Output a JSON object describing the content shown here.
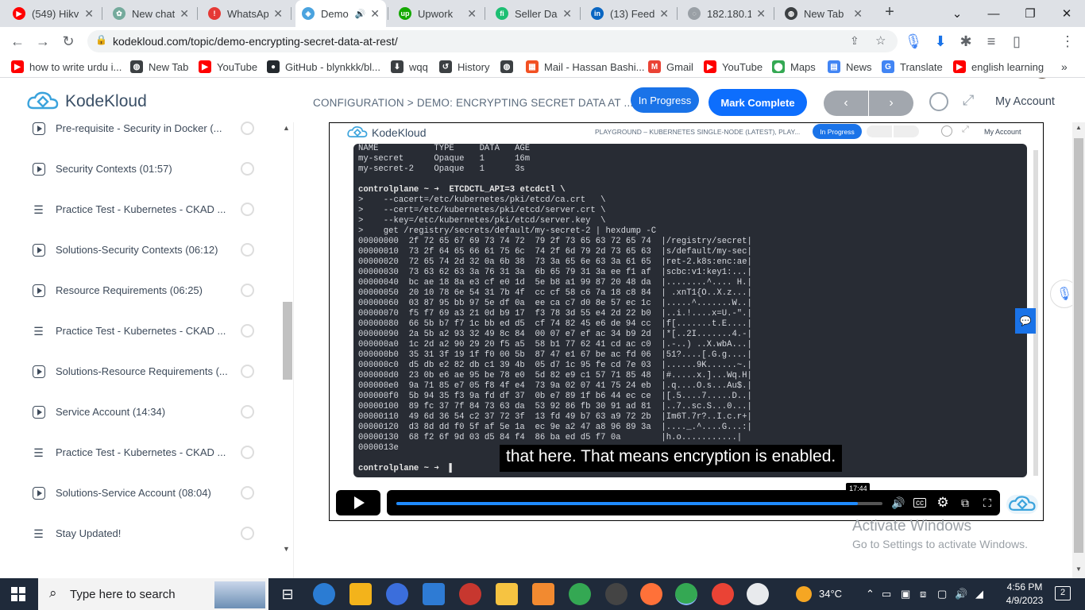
{
  "browser": {
    "tabs": [
      {
        "title": "(549) Hikvi",
        "fav_color": "#ff0000",
        "fav_glyph": "▶"
      },
      {
        "title": "New chat",
        "fav_color": "#74aa9c",
        "fav_glyph": "✿"
      },
      {
        "title": "WhatsApp",
        "fav_color": "#e53935",
        "fav_glyph": "!"
      },
      {
        "title": "Demo",
        "fav_color": "#4aa3df",
        "fav_glyph": "◈",
        "active": true
      },
      {
        "title": "Upwork",
        "fav_color": "#14a800",
        "fav_glyph": "up"
      },
      {
        "title": "Seller Dash",
        "fav_color": "#1dbf73",
        "fav_glyph": "fi"
      },
      {
        "title": "(13) Feed |",
        "fav_color": "#0a66c2",
        "fav_glyph": "in"
      },
      {
        "title": "182.180.14",
        "fav_color": "#9aa0a6",
        "fav_glyph": "◌"
      },
      {
        "title": "New Tab",
        "fav_color": "#3c4043",
        "fav_glyph": "◍"
      }
    ],
    "new_tab_symbol": "+",
    "window_controls": [
      "⌄",
      "—",
      "❐",
      "✕"
    ],
    "url": "kodekloud.com/topic/demo-encrypting-secret-data-at-rest/",
    "bookmarks": [
      {
        "label": "how to write urdu i...",
        "color": "#ff0000",
        "glyph": "▶"
      },
      {
        "label": "New Tab",
        "color": "#3c4043",
        "glyph": "◍"
      },
      {
        "label": "YouTube",
        "color": "#ff0000",
        "glyph": "▶"
      },
      {
        "label": "GitHub - blynkkk/bl...",
        "color": "#24292e",
        "glyph": "●"
      },
      {
        "label": "wqq",
        "color": "#3c4043",
        "glyph": "⬇"
      },
      {
        "label": "History",
        "color": "#3c4043",
        "glyph": "↺"
      },
      {
        "label": "",
        "color": "#3c4043",
        "glyph": "◍"
      },
      {
        "label": "Mail - Hassan Bashi...",
        "color": "#f25022",
        "glyph": "▦"
      },
      {
        "label": "Gmail",
        "color": "#ea4335",
        "glyph": "M"
      },
      {
        "label": "YouTube",
        "color": "#ff0000",
        "glyph": "▶"
      },
      {
        "label": "Maps",
        "color": "#34a853",
        "glyph": "⬤"
      },
      {
        "label": "News",
        "color": "#4285f4",
        "glyph": "▤"
      },
      {
        "label": "Translate",
        "color": "#4285f4",
        "glyph": "G"
      },
      {
        "label": "english learning",
        "color": "#ff0000",
        "glyph": "▶"
      }
    ]
  },
  "app": {
    "logo_text": "KodeKloud",
    "breadcrumb": "CONFIGURATION > DEMO: ENCRYPTING SECRET DATA AT ...",
    "in_progress": "In Progress",
    "mark_complete": "Mark Complete",
    "prev": "‹",
    "next": "›",
    "account": "My Account",
    "accent": "#1a73e8",
    "mark_color": "#0d6efd"
  },
  "sidebar": {
    "items": [
      {
        "label": "Pre-requisite - Security in Docker (...",
        "type": "video"
      },
      {
        "label": "Security Contexts (01:57)",
        "type": "video"
      },
      {
        "label": "Practice Test - Kubernetes - CKAD ...",
        "type": "lab"
      },
      {
        "label": "Solutions-Security Contexts (06:12)",
        "type": "video"
      },
      {
        "label": "Resource Requirements (06:25)",
        "type": "video"
      },
      {
        "label": "Practice Test - Kubernetes - CKAD ...",
        "type": "lab"
      },
      {
        "label": "Solutions-Resource Requirements (...",
        "type": "video"
      },
      {
        "label": "Service Account (14:34)",
        "type": "video"
      },
      {
        "label": "Practice Test - Kubernetes - CKAD ...",
        "type": "lab"
      },
      {
        "label": "Solutions-Service Account (08:04)",
        "type": "video"
      },
      {
        "label": "Stay Updated!",
        "type": "lab"
      }
    ]
  },
  "video": {
    "inner_logo": "KodeKloud",
    "inner_breadcrumb": "PLAYGROUND – KUBERNETES SINGLE-NODE (LATEST), PLAY...",
    "inner_progress": "In Progress",
    "inner_account": "My Account",
    "terminal_lines": [
      "NAME           TYPE     DATA   AGE",
      "my-secret      Opaque   1      16m",
      "my-secret-2    Opaque   1      3s",
      "",
      "controlplane ~ ➜  ETCDCTL_API=3 etcdctl \\",
      ">    --cacert=/etc/kubernetes/pki/etcd/ca.crt   \\",
      ">    --cert=/etc/kubernetes/pki/etcd/server.crt \\",
      ">    --key=/etc/kubernetes/pki/etcd/server.key  \\",
      ">    get /registry/secrets/default/my-secret-2 | hexdump -C",
      "00000000  2f 72 65 67 69 73 74 72  79 2f 73 65 63 72 65 74  |/registry/secret|",
      "00000010  73 2f 64 65 66 61 75 6c  74 2f 6d 79 2d 73 65 63  |s/default/my-sec|",
      "00000020  72 65 74 2d 32 0a 6b 38  73 3a 65 6e 63 3a 61 65  |ret-2.k8s:enc:ae|",
      "00000030  73 63 62 63 3a 76 31 3a  6b 65 79 31 3a ee f1 af  |scbc:v1:key1:...|",
      "00000040  bc ae 18 8a e3 cf e0 1d  5e b8 a1 99 87 20 48 da  |........^.... H.|",
      "00000050  20 10 78 6e 54 31 7b 4f  cc cf 58 c6 7a 18 c8 84  | .xnT1{O..X.z...|",
      "00000060  03 87 95 bb 97 5e df 0a  ee ca c7 d0 8e 57 ec 1c  |.....^.......W..|",
      "00000070  f5 f7 69 a3 21 0d b9 17  f3 78 3d 55 e4 2d 22 b0  |..i.!....x=U.-\".|",
      "00000080  66 5b b7 f7 1c bb ed d5  cf 74 82 45 e6 de 94 cc  |f[.......t.E....|",
      "00000090  2a 5b a2 93 32 49 8c 84  00 07 e7 ef ac 34 b9 2d  |*[..2I.......4.-|",
      "000000a0  1c 2d a2 90 29 20 f5 a5  58 b1 77 62 41 cd ac c0  |.-..) ..X.wbA...|",
      "000000b0  35 31 3f 19 1f f0 00 5b  87 47 e1 67 be ac fd 06  |51?....[.G.g....|",
      "000000c0  d5 db e2 82 db c1 39 4b  05 d7 1c 95 fe cd 7e 03  |......9K......~.|",
      "000000d0  23 0b e6 ae 95 be 78 e0  5d 82 e9 c1 57 71 85 48  |#.....x.]...Wq.H|",
      "000000e0  9a 71 85 e7 05 f8 4f e4  73 9a 02 07 41 75 24 eb  |.q....O.s...Au$.|",
      "000000f0  5b 94 35 f3 9a fd df 37  0b e7 89 1f b6 44 ec ce  |[.5....7.....D..|",
      "00000100  89 fc 37 7f 84 73 63 da  53 92 86 fb 30 91 ad 81  |..7..sc.S...0...|",
      "00000110  49 6d 36 54 c2 37 72 3f  13 fd 49 b7 63 a9 72 2b  |Im6T.7r?..I.c.r+|",
      "00000120  d3 8d dd f0 5f af 5e 1a  ec 9e a2 47 a8 96 89 3a  |...._.^....G...:|",
      "00000130  68 f2 6f 9d 03 d5 84 f4  86 ba ed d5 f7 0a        |h.o...........|",
      "0000013e",
      "",
      "controlplane ~ ➜  ▌"
    ],
    "caption": "that here. That means encryption is enabled.",
    "time_tooltip": "17:44",
    "progress_fraction": 0.95
  },
  "watermark": {
    "line1": "Activate Windows",
    "line2": "Go to Settings to activate Windows."
  },
  "taskbar": {
    "search_placeholder": "Type here to search",
    "temperature": "34°C",
    "time": "4:56 PM",
    "date": "4/9/2023",
    "notifications": "2"
  }
}
